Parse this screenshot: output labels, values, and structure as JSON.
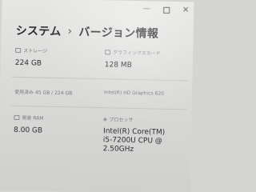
{
  "window": {
    "minimize_icon": "minimize-icon",
    "restore_icon": "restore-icon",
    "close_icon": "close-icon"
  },
  "breadcrumb": {
    "parent": "システム",
    "separator": "›",
    "current": "バージョン情報"
  },
  "specs": {
    "storage": {
      "label": "ストレージ",
      "value": "224 GB"
    },
    "graphics_card": {
      "label": "グラフィックスカード",
      "value": "128 MB"
    },
    "storage_used": {
      "label": "使用済み 45 GB / 224 GB"
    },
    "gpu_name": {
      "label": "Intel(R) HD Graphics 620"
    },
    "ram": {
      "label": "実装 RAM",
      "value": "8.00 GB"
    },
    "processor": {
      "label": "プロセッサ",
      "value_line1": "Intel(R) Core(TM)",
      "value_line2": "i5-7200U CPU @",
      "value_line3": "2.50GHz"
    }
  }
}
